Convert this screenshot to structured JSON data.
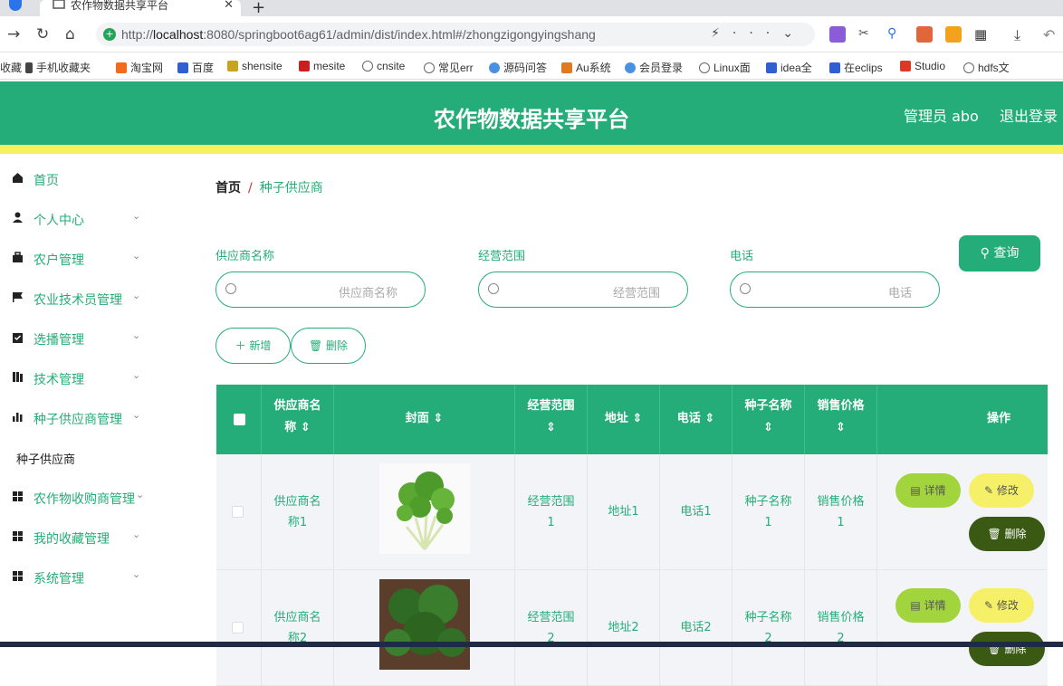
{
  "browser": {
    "tab_title": "农作物数据共享平台",
    "url_prefix": "http://",
    "url_host": "localhost",
    "url_rest": ":8080/springboot6ag61/admin/dist/index.html#/zhongzigongyingshang",
    "bookmarks": [
      "收藏",
      "手机收藏夹",
      "淘宝网",
      "百度",
      "shensite",
      "mesite",
      "cnsite",
      "常见err",
      "源码问答",
      "Au系统",
      "会员登录",
      "Linux面",
      "idea全",
      "在eclips",
      "Studio",
      "hdfs文"
    ]
  },
  "header": {
    "title": "农作物数据共享平台",
    "user": "管理员 abo",
    "logout": "退出登录"
  },
  "sidebar": {
    "items": [
      {
        "label": "首页",
        "icon": "home-icon",
        "arrow": false
      },
      {
        "label": "个人中心",
        "icon": "user-icon",
        "arrow": true
      },
      {
        "label": "农户管理",
        "icon": "briefcase-icon",
        "arrow": true
      },
      {
        "label": "农业技术员管理",
        "icon": "flag-icon",
        "arrow": true
      },
      {
        "label": "选播管理",
        "icon": "clipboard-check-icon",
        "arrow": true
      },
      {
        "label": "技术管理",
        "icon": "books-icon",
        "arrow": true
      },
      {
        "label": "种子供应商管理",
        "icon": "bar-chart-icon",
        "arrow": true
      }
    ],
    "sub_item": "种子供应商",
    "items_after": [
      {
        "label": "农作物收购商管理",
        "icon": "grid-icon",
        "arrow": true
      },
      {
        "label": "我的收藏管理",
        "icon": "grid-icon",
        "arrow": true
      },
      {
        "label": "系统管理",
        "icon": "grid-icon",
        "arrow": true
      }
    ]
  },
  "breadcrumb": {
    "home": "首页",
    "separator": "/",
    "current": "种子供应商"
  },
  "filters": {
    "supplier_label": "供应商名称",
    "supplier_placeholder": "供应商名称",
    "scope_label": "经营范围",
    "scope_placeholder": "经营范围",
    "phone_label": "电话",
    "phone_placeholder": "电话",
    "query": "查询"
  },
  "actions": {
    "add": "新增",
    "delete": "删除"
  },
  "table": {
    "headers": {
      "supplier": "供应商名称",
      "cover": "封面",
      "scope": "经营范围",
      "address": "地址",
      "phone": "电话",
      "seed_name": "种子名称",
      "price": "销售价格",
      "ops": "操作"
    },
    "rows": [
      {
        "supplier": "供应商名称1",
        "scope": "经营范围1",
        "address": "地址1",
        "phone": "电话1",
        "seed_name": "种子名称1",
        "price": "销售价格1"
      },
      {
        "supplier": "供应商名称2",
        "scope": "经营范围2",
        "address": "地址2",
        "phone": "电话2",
        "seed_name": "种子名称2",
        "price": "销售价格2"
      }
    ],
    "row_buttons": {
      "detail": "详情",
      "edit": "修改",
      "delete": "删除"
    }
  },
  "colors": {
    "primary": "#24ad78",
    "accent_yellow": "#f6f25e",
    "detail_btn": "#a2d43d",
    "edit_btn": "#f5f067",
    "delete_btn": "#3a5a14"
  }
}
